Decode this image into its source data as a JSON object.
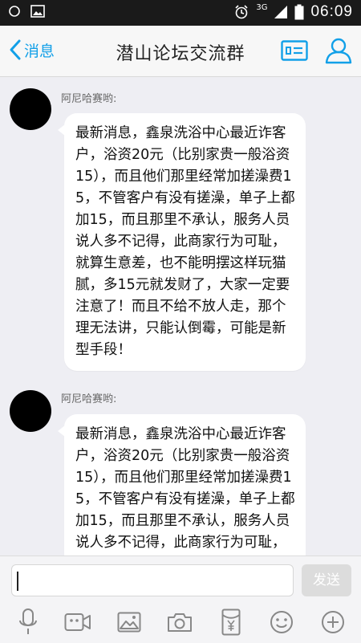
{
  "status_bar": {
    "network": "3G",
    "time": "06:09"
  },
  "header": {
    "back_label": "消息",
    "title": "潜山论坛交流群"
  },
  "messages": [
    {
      "sender": "阿尼哈赛哟:",
      "text": "最新消息，鑫泉洗浴中心最近诈客户，浴资20元（比别家贵一般浴资15），而且他们那里经常加搓澡费15，不管客户有没有搓澡，单子上都加15，而且那里不承认，服务人员说人多不记得，此商家行为可耻，就算生意差，也不能明摆这样玩猫腻，多15元就发财了，大家一定要注意了！而且不给不放人走，那个理无法讲，只能认倒霉，可能是新型手段！"
    },
    {
      "sender": "阿尼哈赛哟:",
      "text": "最新消息，鑫泉洗浴中心最近诈客户，浴资20元（比别家贵一般浴资15），而且他们那里经常加搓澡费15，不管客户有没有搓澡，单子上都加15，而且那里不承认，服务人员说人多不记得，此商家行为可耻，就算生意"
    }
  ],
  "input": {
    "value": "",
    "send_label": "发送"
  },
  "toolbar": {
    "icons": [
      "microphone-icon",
      "video-icon",
      "image-icon",
      "camera-icon",
      "red-packet-icon",
      "emoji-icon",
      "plus-icon"
    ]
  },
  "colors": {
    "accent": "#12a0e8",
    "background": "#eeeef3"
  }
}
